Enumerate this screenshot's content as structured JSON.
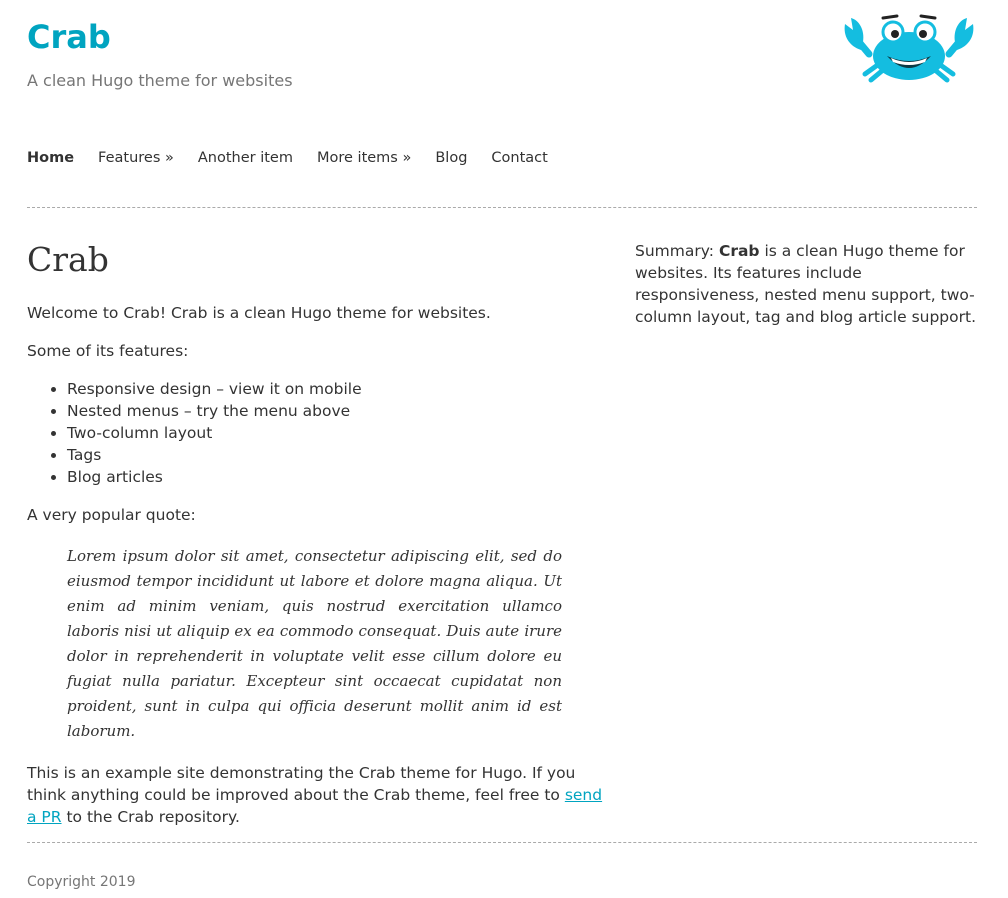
{
  "header": {
    "title": "Crab",
    "subtitle": "A clean Hugo theme for websites",
    "logo_icon": "crab-mascot-icon",
    "accent_color": "#00a4c0"
  },
  "nav": {
    "items": [
      {
        "label": "Home",
        "active": true
      },
      {
        "label": "Features »"
      },
      {
        "label": "Another item"
      },
      {
        "label": "More items »"
      },
      {
        "label": "Blog"
      },
      {
        "label": "Contact"
      }
    ]
  },
  "main": {
    "title": "Crab",
    "welcome": "Welcome to Crab! Crab is a clean Hugo theme for websites.",
    "features_intro": "Some of its features:",
    "features": [
      "Responsive design – view it on mobile",
      "Nested menus – try the menu above",
      "Two-column layout",
      "Tags",
      "Blog articles"
    ],
    "quote_intro": "A very popular quote:",
    "quote": "Lorem ipsum dolor sit amet, consectetur adipiscing elit, sed do eiusmod tempor incididunt ut labore et dolore magna aliqua. Ut enim ad minim veniam, quis nostrud exercitation ullamco laboris nisi ut aliquip ex ea commodo consequat. Duis aute irure dolor in reprehenderit in voluptate velit esse cillum dolore eu fugiat nulla pariatur. Excepteur sint occaecat cupidatat non proident, sunt in culpa qui officia deserunt mollit anim id est laborum.",
    "closing_before": "This is an example site demonstrating the Crab theme for Hugo. If you think anything could be improved about the Crab theme, feel free to ",
    "closing_link": "send a PR",
    "closing_after": " to the Crab repository."
  },
  "sidebar": {
    "summary_label": "Summary: ",
    "summary_bold": "Crab",
    "summary_text": " is a clean Hugo theme for websites. Its features include responsiveness, nested menu support, two-column layout, tag and blog article support."
  },
  "footer": {
    "copyright": "Copyright 2019"
  }
}
